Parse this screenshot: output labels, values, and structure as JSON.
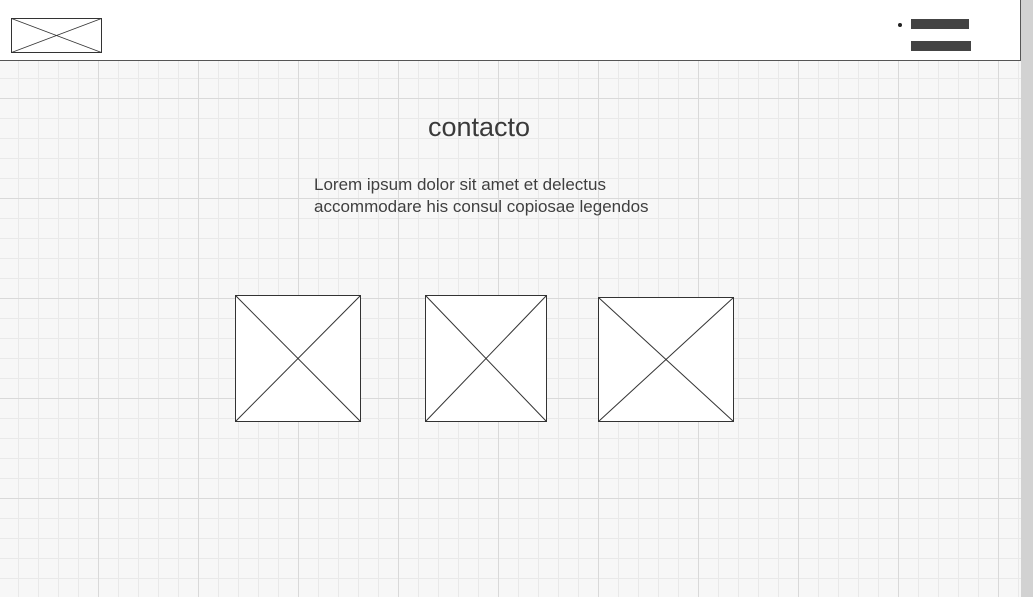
{
  "header": {
    "logo_icon": "image-placeholder-icon",
    "menu_icon": "hamburger-menu-icon"
  },
  "main": {
    "title": "contacto",
    "description_line1": "Lorem ipsum dolor sit amet et delectus",
    "description_line2": "accommodare his consul copiosae legendos",
    "images": [
      {
        "icon": "image-placeholder-icon"
      },
      {
        "icon": "image-placeholder-icon"
      },
      {
        "icon": "image-placeholder-icon"
      }
    ]
  },
  "colors": {
    "grid_background": "#f7f7f7",
    "header_background": "#ffffff",
    "text": "#3a3a3a",
    "menu_bars": "#444444"
  }
}
